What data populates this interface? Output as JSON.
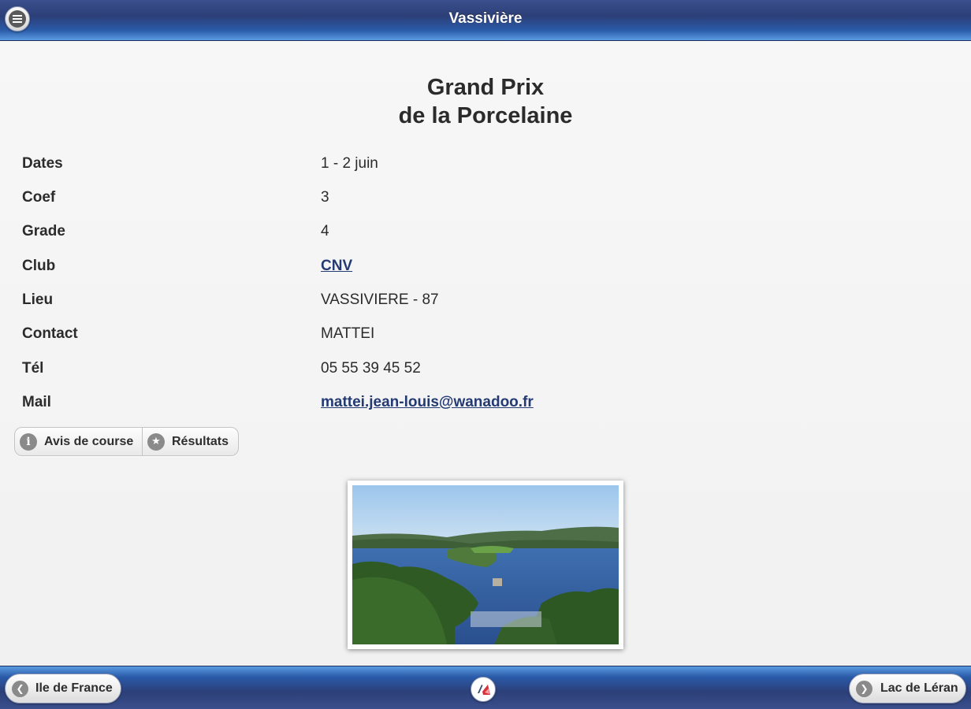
{
  "header": {
    "title": "Vassivière",
    "menu_icon": "menu-icon"
  },
  "event": {
    "title_line1": "Grand Prix",
    "title_line2": "de la Porcelaine"
  },
  "details": [
    {
      "label": "Dates",
      "value": "1 - 2 juin"
    },
    {
      "label": "Coef",
      "value": "3"
    },
    {
      "label": "Grade",
      "value": "4"
    },
    {
      "label": "Club",
      "value": "CNV"
    },
    {
      "label": "Lieu",
      "value": "VASSIVIERE - 87"
    },
    {
      "label": "Contact",
      "value": "MATTEI"
    },
    {
      "label": "Tél",
      "value": "05 55 39 45 52"
    },
    {
      "label": "Mail",
      "value": "mattei.jean-louis@wanadoo.fr"
    }
  ],
  "actions": {
    "notice_label": "Avis de course",
    "results_label": "Résultats"
  },
  "footer": {
    "prev_label": "Ile de France",
    "next_label": "Lac de Léran"
  },
  "colors": {
    "bar_dark": "#2c3f78",
    "bar_light": "#5b9be0",
    "link": "#243a73",
    "background": "#f4f4f4"
  }
}
